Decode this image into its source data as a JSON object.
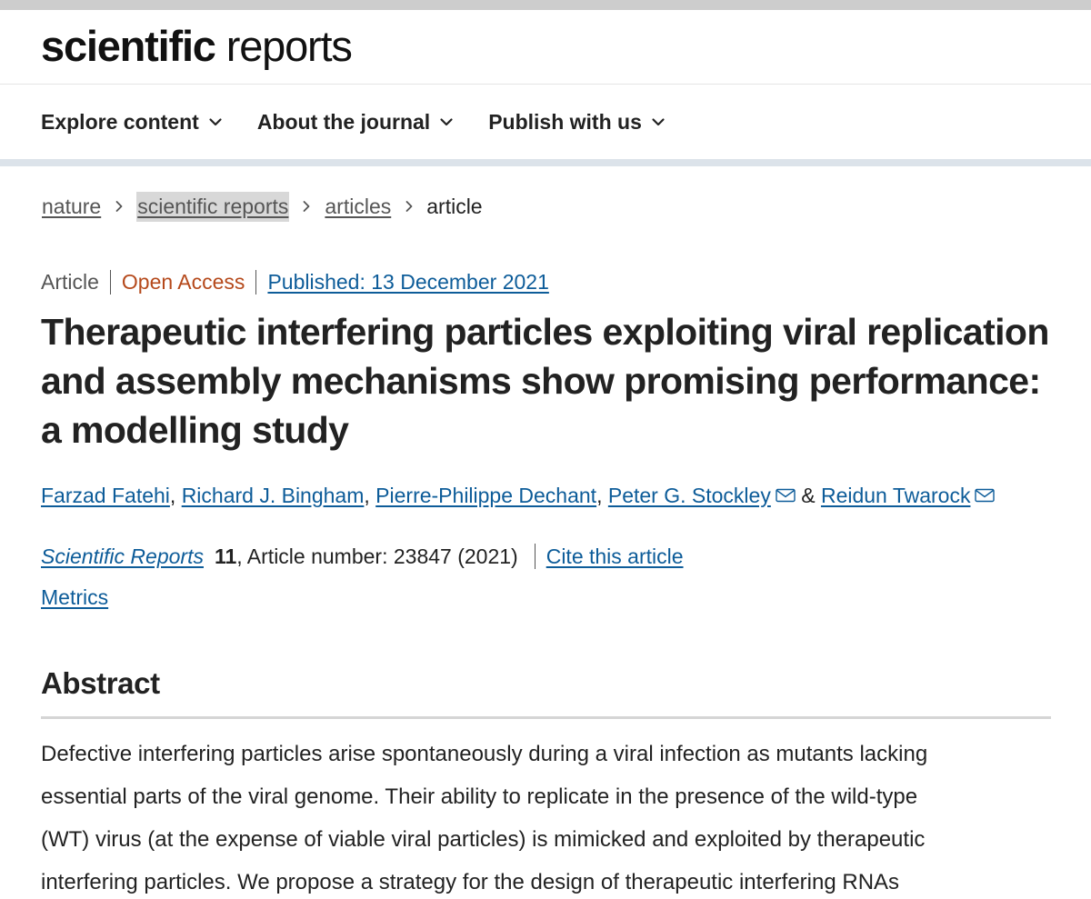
{
  "brand": {
    "logo_bold": "scientific",
    "logo_light": "reports"
  },
  "nav": {
    "items": [
      {
        "label": "Explore content"
      },
      {
        "label": "About the journal"
      },
      {
        "label": "Publish with us"
      }
    ]
  },
  "breadcrumb": {
    "items": [
      "nature",
      "scientific reports",
      "articles"
    ],
    "current": "article"
  },
  "article": {
    "type": "Article",
    "access": "Open Access",
    "published": "Published: 13 December 2021",
    "title": "Therapeutic interfering particles exploiting viral replication and assembly mechanisms show promising performance: a modelling study",
    "authors": [
      "Farzad Fatehi",
      "Richard J. Bingham",
      "Pierre-Philippe Dechant",
      "Peter G. Stockley",
      "Reidun Twarock"
    ],
    "author_sep": ",",
    "author_and": "&",
    "journal": "Scientific Reports",
    "volume": "11",
    "article_number": ", Article number: 23847 (2021)",
    "cite_label": "Cite this article",
    "metrics_label": "Metrics"
  },
  "abstract": {
    "heading": "Abstract",
    "lines": [
      "Defective interfering particles arise spontaneously during a viral infection as mutants lacking",
      "essential parts of the viral genome. Their ability to replicate in the presence of the wild-type",
      "(WT) virus (at the expense of viable viral particles) is mimicked and exploited by therapeutic",
      "interfering particles. We propose a strategy for the design of therapeutic interfering RNAs"
    ]
  },
  "colors": {
    "link": "#0d5c99",
    "open_access": "#b5491b",
    "nav_rule": "#dce3ea"
  }
}
